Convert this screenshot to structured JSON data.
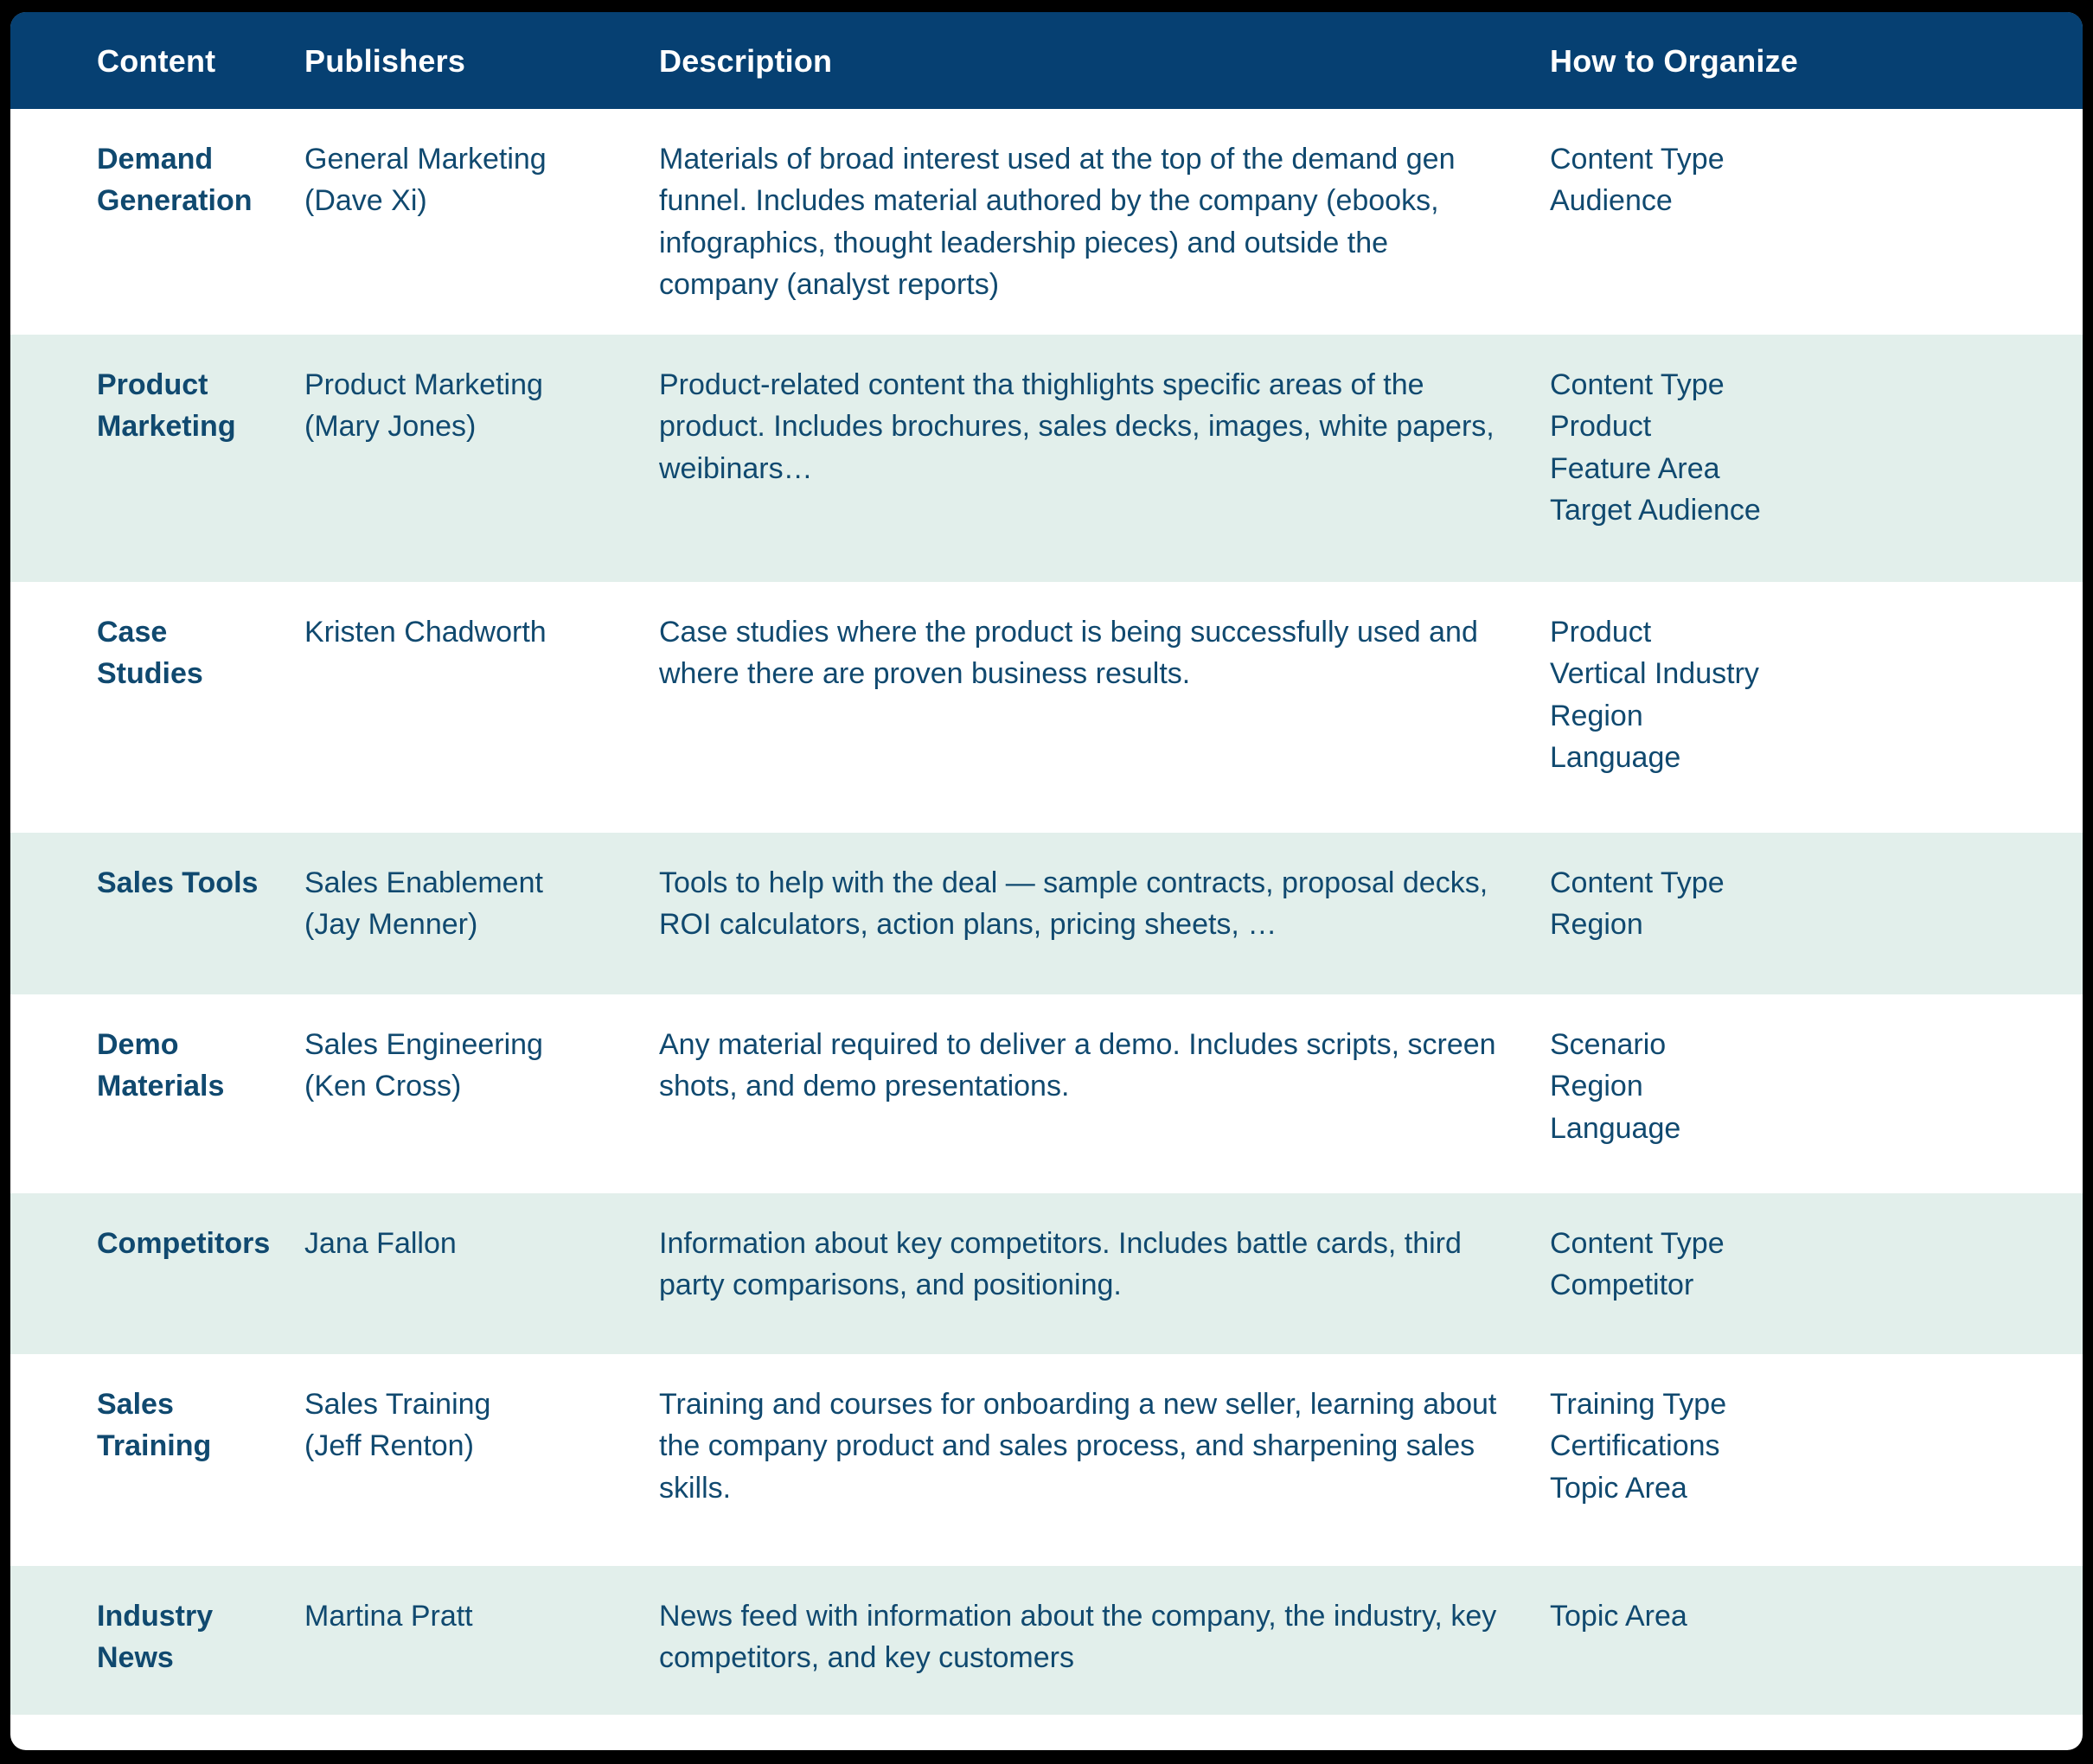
{
  "table": {
    "columns": [
      {
        "key": "content",
        "label": "Content"
      },
      {
        "key": "publishers",
        "label": "Publishers"
      },
      {
        "key": "description",
        "label": "Description"
      },
      {
        "key": "organize",
        "label": "How to Organize"
      }
    ],
    "colors": {
      "header_background": "#064072",
      "header_text": "#ffffff",
      "row_background": "#ffffff",
      "row_alt_background": "#e2efeb",
      "body_text": "#10496f",
      "page_background": "#000000"
    },
    "rows": [
      {
        "content": [
          "Demand",
          "Generation"
        ],
        "publishers": [
          "General Marketing",
          "(Dave Xi)"
        ],
        "description": "Materials of broad interest used at the top of the demand gen funnel. Includes material authored by the company (ebooks, infographics, thought leadership pieces) and outside the company (analyst reports)",
        "organize": [
          "Content Type",
          "Audience"
        ]
      },
      {
        "content": [
          "Product",
          "Marketing"
        ],
        "publishers": [
          "Product Marketing",
          "(Mary Jones)"
        ],
        "description": "Product-related content tha thighlights specific areas of the product. Includes brochures, sales decks, images, white papers, weibinars…",
        "organize": [
          "Content Type",
          "Product",
          "Feature Area",
          "Target Audience"
        ]
      },
      {
        "content": [
          "Case Studies"
        ],
        "publishers": [
          "Kristen Chadworth"
        ],
        "description": "Case studies where the product is being successfully used and where there are proven business results.",
        "organize": [
          "Product",
          "Vertical Industry",
          "Region",
          "Language"
        ]
      },
      {
        "content": [
          "Sales Tools"
        ],
        "publishers": [
          "Sales Enablement",
          "(Jay Menner)"
        ],
        "description": "Tools to help with the deal — sample contracts, proposal decks, ROI calculators, action plans, pricing sheets, …",
        "organize": [
          "Content Type",
          "Region"
        ]
      },
      {
        "content": [
          "Demo Materials"
        ],
        "publishers": [
          "Sales Engineering",
          "(Ken Cross)"
        ],
        "description": "Any material required to deliver a demo. Includes scripts, screen shots, and demo presentations.",
        "organize": [
          "Scenario",
          "Region",
          "Language"
        ]
      },
      {
        "content": [
          "Competitors"
        ],
        "publishers": [
          "Jana Fallon"
        ],
        "description": "Information about key competitors. Includes battle cards, third party comparisons, and positioning.",
        "organize": [
          "Content Type",
          "Competitor"
        ]
      },
      {
        "content": [
          "Sales Training"
        ],
        "publishers": [
          "Sales Training",
          "(Jeff Renton)"
        ],
        "description": "Training and courses for onboarding a new seller, learning about the company product and sales process, and sharpening sales skills.",
        "organize": [
          "Training Type",
          "Certifications",
          "Topic Area"
        ]
      },
      {
        "content": [
          "Industry News"
        ],
        "publishers": [
          "Martina Pratt"
        ],
        "description": "News feed with information about the company, the industry, key competitors, and key customers",
        "organize": [
          "Topic Area"
        ]
      }
    ]
  }
}
